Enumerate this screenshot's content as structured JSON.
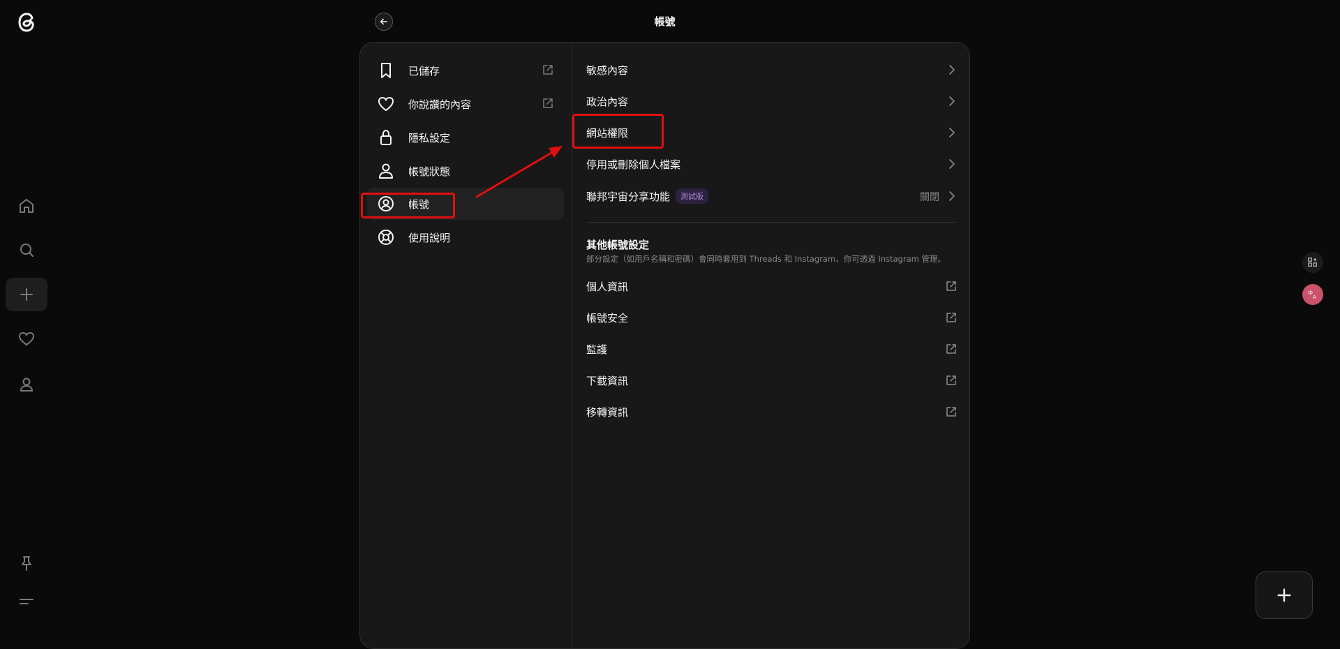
{
  "nav": {
    "logo_icon": "threads-logo-icon",
    "items": [
      {
        "icon": "home-icon"
      },
      {
        "icon": "search-icon"
      },
      {
        "icon": "plus-icon"
      },
      {
        "icon": "heart-icon"
      },
      {
        "icon": "profile-icon"
      }
    ],
    "bottom_items": [
      {
        "icon": "pin-icon"
      },
      {
        "icon": "menu-icon"
      }
    ]
  },
  "header": {
    "back_icon": "arrow-left-icon",
    "title": "帳號"
  },
  "settings_menu": [
    {
      "label": "已儲存",
      "icon": "bookmark-icon",
      "external": true
    },
    {
      "label": "你說讚的內容",
      "icon": "heart-icon",
      "external": true
    },
    {
      "label": "隱私設定",
      "icon": "lock-icon",
      "external": false
    },
    {
      "label": "帳號狀態",
      "icon": "person-icon",
      "external": false
    },
    {
      "label": "帳號",
      "icon": "account-circle-icon",
      "external": false,
      "selected": true
    },
    {
      "label": "使用說明",
      "icon": "lifebuoy-icon",
      "external": false
    }
  ],
  "account_options": [
    {
      "label": "敏感內容"
    },
    {
      "label": "政治內容"
    },
    {
      "label": "網站權限"
    },
    {
      "label": "停用或刪除個人檔案"
    },
    {
      "label": "聯邦宇宙分享功能",
      "badge": "測試版",
      "value": "關閉"
    }
  ],
  "other_settings": {
    "title": "其他帳號設定",
    "description": "部分設定（如用戶名稱和密碼）會同時套用到 Threads 和 Instagram，你可透過 Instagram 管理。",
    "items": [
      {
        "label": "個人資訊"
      },
      {
        "label": "帳號安全"
      },
      {
        "label": "監護"
      },
      {
        "label": "下載資訊"
      },
      {
        "label": "移轉資訊"
      }
    ]
  },
  "side_tools": [
    {
      "icon": "grid-add-icon"
    },
    {
      "icon": "translate-icon"
    }
  ],
  "fab": {
    "icon": "plus-icon"
  },
  "colors": {
    "background": "#0a0a0a",
    "panel": "#181818",
    "annotation_red": "#e01010",
    "badge_bg": "#2d2140",
    "badge_text": "#a98bd6"
  }
}
